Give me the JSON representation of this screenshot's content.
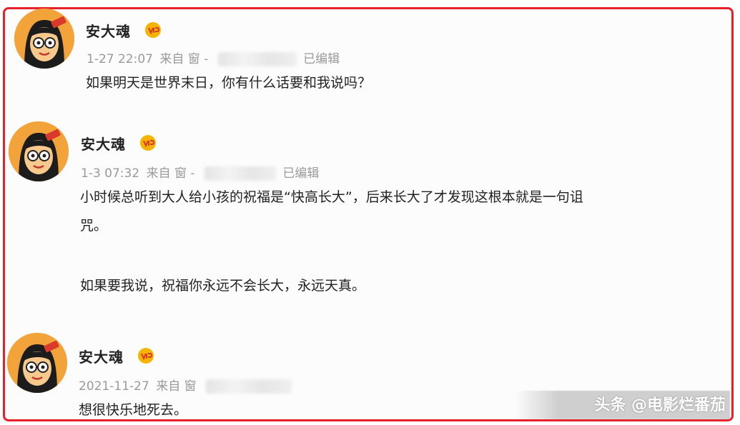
{
  "posts": [
    {
      "name": "安大魂",
      "time": "1-27 22:07",
      "source_label": "来自 窗 -",
      "edited": "已编辑",
      "text": [
        "如果明天是世界末日，你有什么话要和我说吗？"
      ]
    },
    {
      "name": "安大魂",
      "time": "1-3 07:32",
      "source_label": "来自 窗 -",
      "edited": "已编辑",
      "text": [
        "小时候总听到大人给小孩的祝福是“快高长大”，后来长大了才发现这根本就是一句诅",
        "咒。",
        "",
        "如果要我说，祝福你永远不会长大，永远天真。"
      ]
    },
    {
      "name": "安大魂",
      "time": "2021-11-27",
      "source_label": "来自 窗",
      "edited": "",
      "text": [
        "想很快乐地死去。"
      ]
    }
  ],
  "watermark": "头条 @电影烂番茄",
  "icons": {
    "avatar": "cartoon-girl-avatar-icon",
    "badge": "vip-badge-icon"
  },
  "colors": {
    "frame": "#e8202a",
    "meta": "#9a9a9a",
    "avatar_bg": "#f2a33a"
  }
}
